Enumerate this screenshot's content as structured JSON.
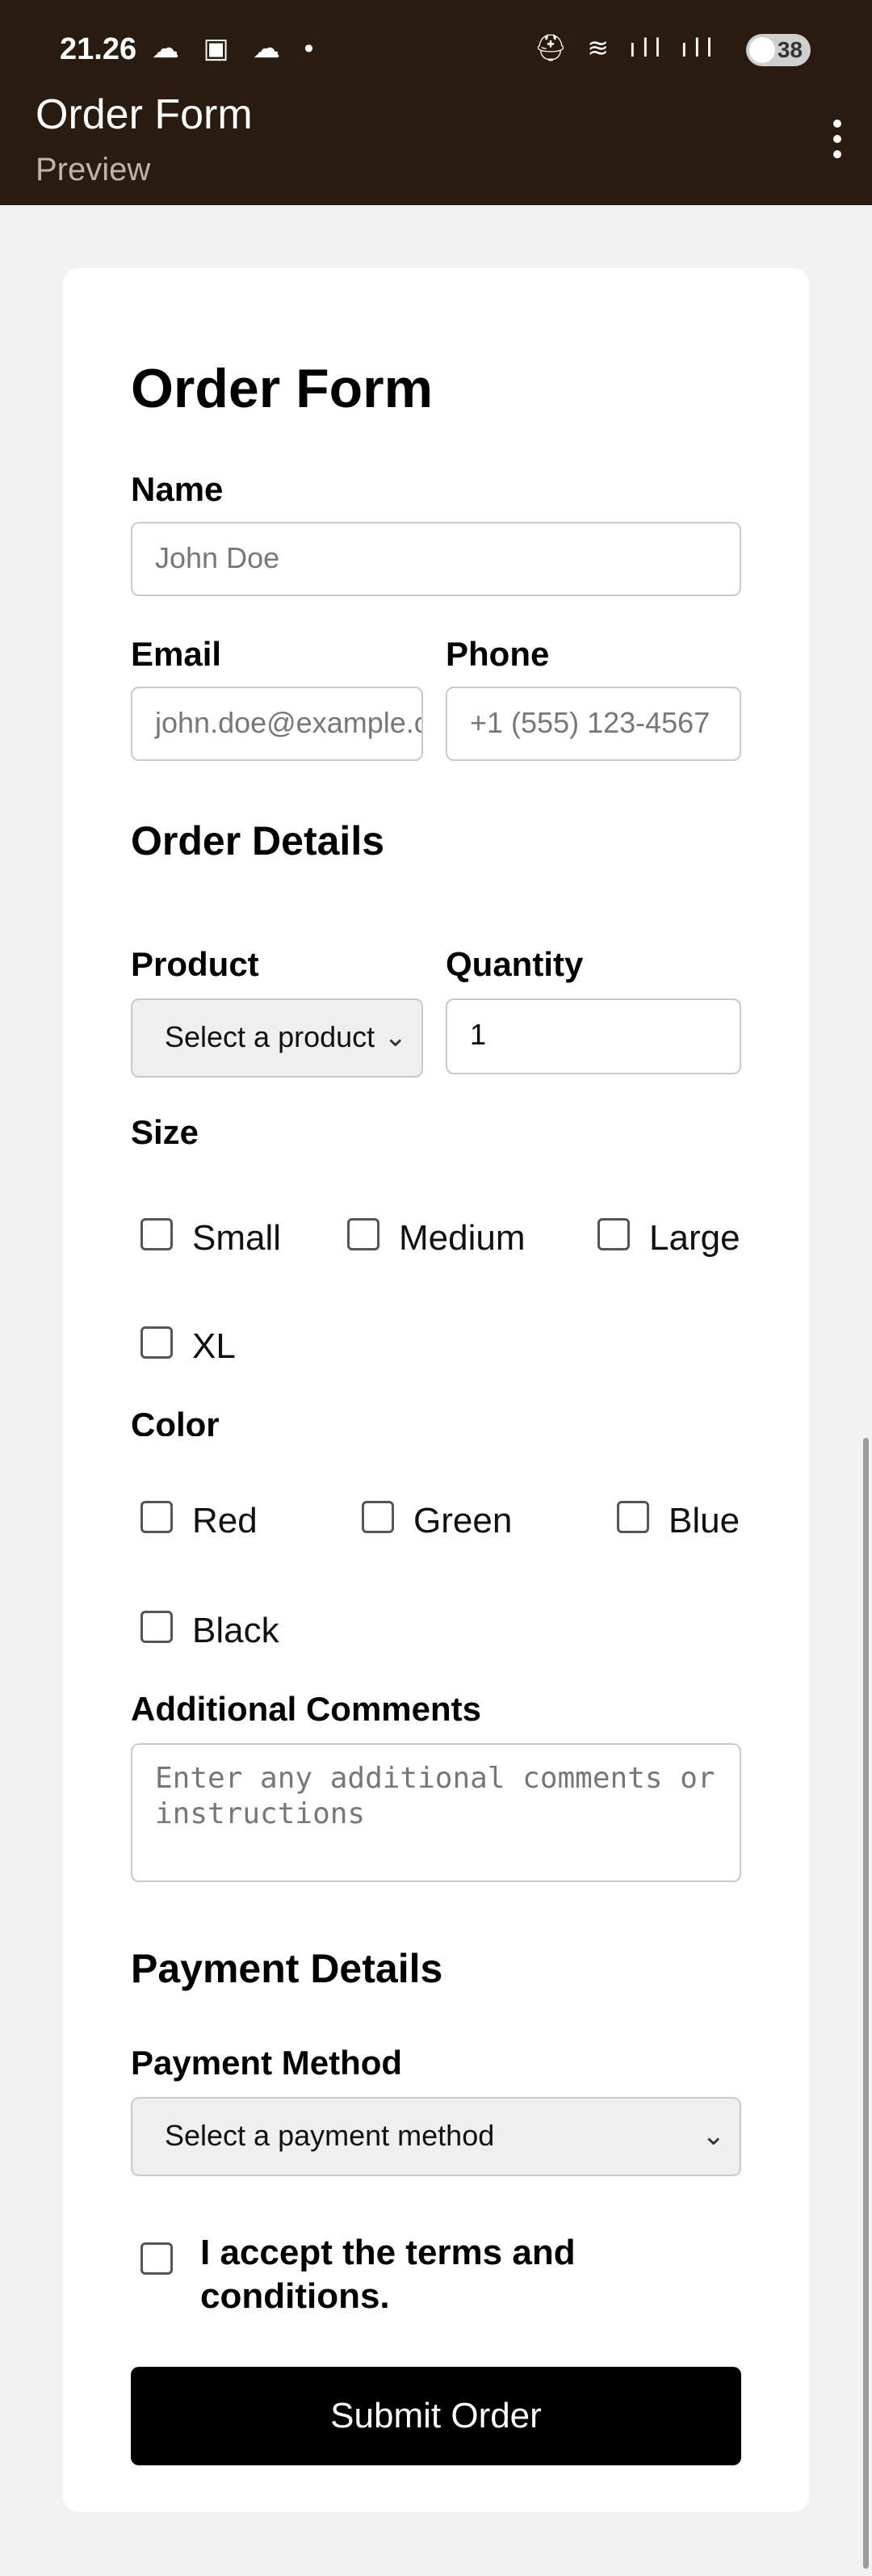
{
  "status_bar": {
    "time": "21.26",
    "left_icons": "☁ ▣ ☁ •",
    "right_icons": "⛑ ≋ ıll ıll",
    "battery": "38"
  },
  "app_bar": {
    "title": "Order Form",
    "subtitle": "Preview",
    "menu_icon": "more-vert-icon"
  },
  "form": {
    "heading": "Order Form",
    "name": {
      "label": "Name",
      "placeholder": "John Doe"
    },
    "email": {
      "label": "Email",
      "placeholder": "john.doe@example.com"
    },
    "phone": {
      "label": "Phone",
      "placeholder": "+1 (555) 123-4567"
    },
    "order_details_heading": "Order Details",
    "product": {
      "label": "Product",
      "selected": "Select a product"
    },
    "quantity": {
      "label": "Quantity",
      "value": "1"
    },
    "size": {
      "label": "Size",
      "options": [
        "Small",
        "Medium",
        "Large",
        "XL"
      ]
    },
    "color": {
      "label": "Color",
      "options": [
        "Red",
        "Green",
        "Blue",
        "Black"
      ]
    },
    "comments": {
      "label": "Additional Comments",
      "placeholder": "Enter any additional comments or instructions"
    },
    "payment_heading": "Payment Details",
    "payment_method": {
      "label": "Payment Method",
      "selected": "Select a payment method"
    },
    "terms_label": "I accept the terms and conditions.",
    "submit_label": "Submit Order"
  }
}
